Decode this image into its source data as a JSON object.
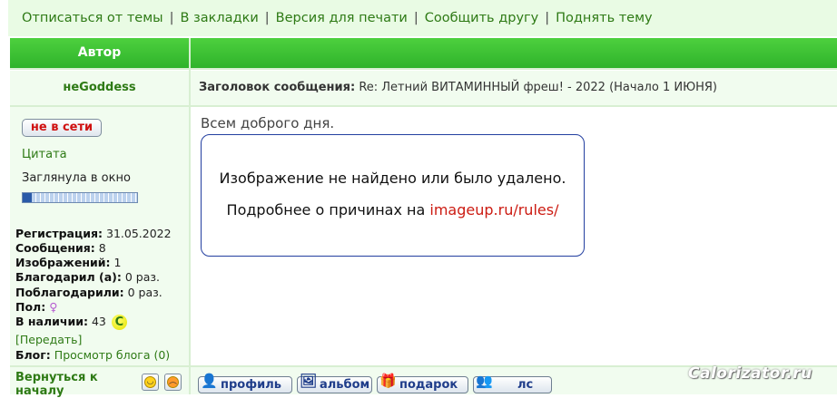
{
  "topbar": {
    "links": [
      "Отписаться от темы",
      "В закладки",
      "Версия для печати",
      "Сообщить другу",
      "Поднять тему"
    ],
    "separator": "|"
  },
  "header": {
    "author_label": "Автор"
  },
  "post": {
    "author": "неGoddess",
    "subject_label": "Заголовок сообщения:",
    "subject": "Re: Летний ВИТАМИННЫЙ фреш! - 2022 (Начало 1 ИЮНЯ)",
    "text": "Всем доброго дня.",
    "image_missing": {
      "line1": "Изображение не найдено или было удалено.",
      "line2_prefix": "Подробнее о причинах на ",
      "line2_link": "imageup.ru/rules/"
    }
  },
  "user": {
    "status_button": "не в сети",
    "quote_link": "Цитата",
    "status_text": "Заглянула в окно",
    "reputation_fraction": 0.08,
    "registration_label": "Регистрация:",
    "registration": "31.05.2022",
    "messages_label": "Сообщения:",
    "messages": "8",
    "images_label": "Изображений:",
    "images": "1",
    "thanked_label": "Благодарил (а):",
    "thanked": "0 раз.",
    "got_thanks_label": "Поблагодарили:",
    "got_thanks": "0 раз.",
    "gender_label": "Пол:",
    "gender_icon": "female-symbol-icon",
    "gender_symbol": "♀",
    "balance_label": "В наличии:",
    "balance": "43",
    "coin_symbol": "С",
    "transfer_link": "[Передать]",
    "blog_label": "Блог:",
    "blog_link": "Просмотр блога (0)"
  },
  "footer": {
    "back_link": "Вернуться к началу",
    "buttons": [
      {
        "label": "профиль",
        "icon": "profile-icon",
        "glyph": "👤"
      },
      {
        "label": "альбом",
        "icon": "album-icon",
        "glyph": "🖼"
      },
      {
        "label": "подарок",
        "icon": "gift-icon",
        "glyph": "🎁"
      },
      {
        "label": "лс",
        "icon": "private-message-icon",
        "glyph": "👥"
      }
    ]
  },
  "watermark": "Calorizator.ru",
  "colors": {
    "green_header": "#3cc233",
    "link_green": "#2e7a15",
    "red": "#cc1b12"
  }
}
